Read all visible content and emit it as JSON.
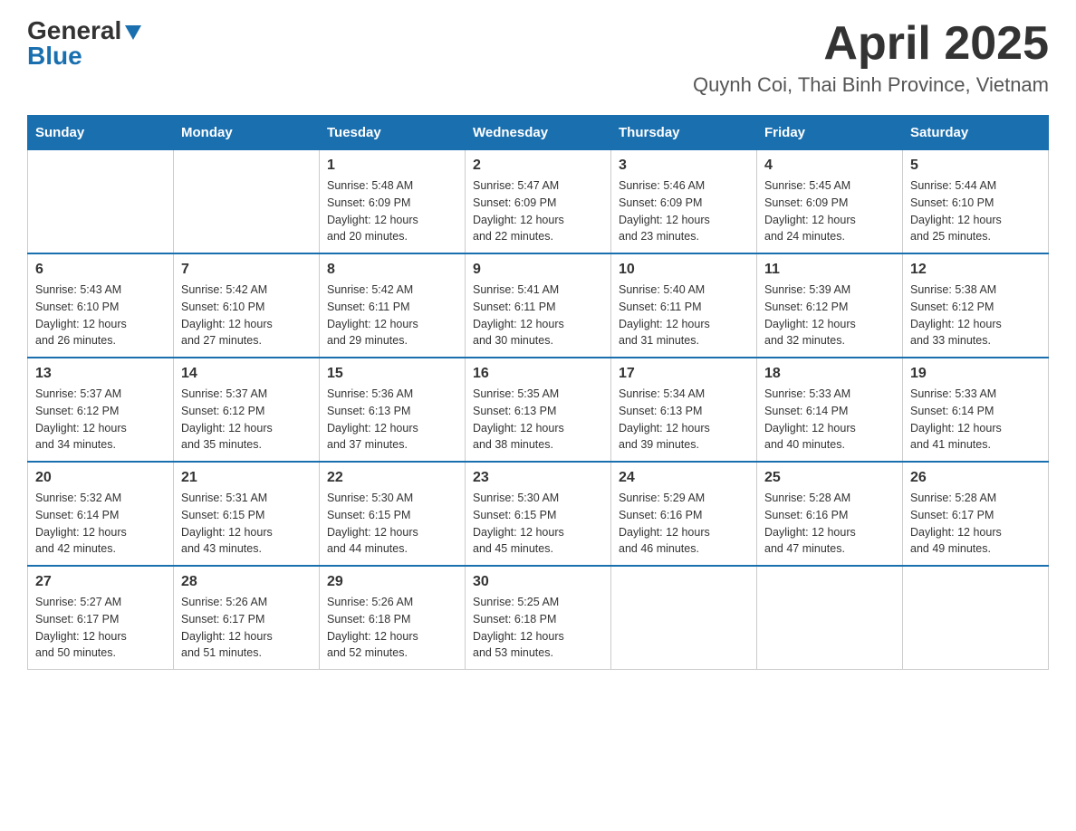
{
  "logo": {
    "general": "General",
    "blue": "Blue"
  },
  "title": "April 2025",
  "subtitle": "Quynh Coi, Thai Binh Province, Vietnam",
  "days_of_week": [
    "Sunday",
    "Monday",
    "Tuesday",
    "Wednesday",
    "Thursday",
    "Friday",
    "Saturday"
  ],
  "weeks": [
    [
      {
        "day": "",
        "info": ""
      },
      {
        "day": "",
        "info": ""
      },
      {
        "day": "1",
        "info": "Sunrise: 5:48 AM\nSunset: 6:09 PM\nDaylight: 12 hours\nand 20 minutes."
      },
      {
        "day": "2",
        "info": "Sunrise: 5:47 AM\nSunset: 6:09 PM\nDaylight: 12 hours\nand 22 minutes."
      },
      {
        "day": "3",
        "info": "Sunrise: 5:46 AM\nSunset: 6:09 PM\nDaylight: 12 hours\nand 23 minutes."
      },
      {
        "day": "4",
        "info": "Sunrise: 5:45 AM\nSunset: 6:09 PM\nDaylight: 12 hours\nand 24 minutes."
      },
      {
        "day": "5",
        "info": "Sunrise: 5:44 AM\nSunset: 6:10 PM\nDaylight: 12 hours\nand 25 minutes."
      }
    ],
    [
      {
        "day": "6",
        "info": "Sunrise: 5:43 AM\nSunset: 6:10 PM\nDaylight: 12 hours\nand 26 minutes."
      },
      {
        "day": "7",
        "info": "Sunrise: 5:42 AM\nSunset: 6:10 PM\nDaylight: 12 hours\nand 27 minutes."
      },
      {
        "day": "8",
        "info": "Sunrise: 5:42 AM\nSunset: 6:11 PM\nDaylight: 12 hours\nand 29 minutes."
      },
      {
        "day": "9",
        "info": "Sunrise: 5:41 AM\nSunset: 6:11 PM\nDaylight: 12 hours\nand 30 minutes."
      },
      {
        "day": "10",
        "info": "Sunrise: 5:40 AM\nSunset: 6:11 PM\nDaylight: 12 hours\nand 31 minutes."
      },
      {
        "day": "11",
        "info": "Sunrise: 5:39 AM\nSunset: 6:12 PM\nDaylight: 12 hours\nand 32 minutes."
      },
      {
        "day": "12",
        "info": "Sunrise: 5:38 AM\nSunset: 6:12 PM\nDaylight: 12 hours\nand 33 minutes."
      }
    ],
    [
      {
        "day": "13",
        "info": "Sunrise: 5:37 AM\nSunset: 6:12 PM\nDaylight: 12 hours\nand 34 minutes."
      },
      {
        "day": "14",
        "info": "Sunrise: 5:37 AM\nSunset: 6:12 PM\nDaylight: 12 hours\nand 35 minutes."
      },
      {
        "day": "15",
        "info": "Sunrise: 5:36 AM\nSunset: 6:13 PM\nDaylight: 12 hours\nand 37 minutes."
      },
      {
        "day": "16",
        "info": "Sunrise: 5:35 AM\nSunset: 6:13 PM\nDaylight: 12 hours\nand 38 minutes."
      },
      {
        "day": "17",
        "info": "Sunrise: 5:34 AM\nSunset: 6:13 PM\nDaylight: 12 hours\nand 39 minutes."
      },
      {
        "day": "18",
        "info": "Sunrise: 5:33 AM\nSunset: 6:14 PM\nDaylight: 12 hours\nand 40 minutes."
      },
      {
        "day": "19",
        "info": "Sunrise: 5:33 AM\nSunset: 6:14 PM\nDaylight: 12 hours\nand 41 minutes."
      }
    ],
    [
      {
        "day": "20",
        "info": "Sunrise: 5:32 AM\nSunset: 6:14 PM\nDaylight: 12 hours\nand 42 minutes."
      },
      {
        "day": "21",
        "info": "Sunrise: 5:31 AM\nSunset: 6:15 PM\nDaylight: 12 hours\nand 43 minutes."
      },
      {
        "day": "22",
        "info": "Sunrise: 5:30 AM\nSunset: 6:15 PM\nDaylight: 12 hours\nand 44 minutes."
      },
      {
        "day": "23",
        "info": "Sunrise: 5:30 AM\nSunset: 6:15 PM\nDaylight: 12 hours\nand 45 minutes."
      },
      {
        "day": "24",
        "info": "Sunrise: 5:29 AM\nSunset: 6:16 PM\nDaylight: 12 hours\nand 46 minutes."
      },
      {
        "day": "25",
        "info": "Sunrise: 5:28 AM\nSunset: 6:16 PM\nDaylight: 12 hours\nand 47 minutes."
      },
      {
        "day": "26",
        "info": "Sunrise: 5:28 AM\nSunset: 6:17 PM\nDaylight: 12 hours\nand 49 minutes."
      }
    ],
    [
      {
        "day": "27",
        "info": "Sunrise: 5:27 AM\nSunset: 6:17 PM\nDaylight: 12 hours\nand 50 minutes."
      },
      {
        "day": "28",
        "info": "Sunrise: 5:26 AM\nSunset: 6:17 PM\nDaylight: 12 hours\nand 51 minutes."
      },
      {
        "day": "29",
        "info": "Sunrise: 5:26 AM\nSunset: 6:18 PM\nDaylight: 12 hours\nand 52 minutes."
      },
      {
        "day": "30",
        "info": "Sunrise: 5:25 AM\nSunset: 6:18 PM\nDaylight: 12 hours\nand 53 minutes."
      },
      {
        "day": "",
        "info": ""
      },
      {
        "day": "",
        "info": ""
      },
      {
        "day": "",
        "info": ""
      }
    ]
  ]
}
